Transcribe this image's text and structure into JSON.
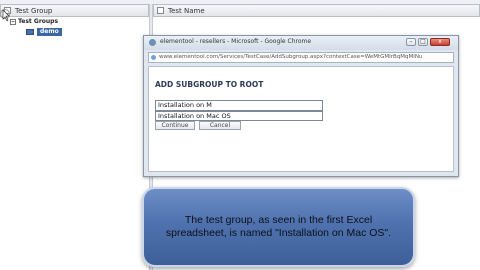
{
  "left_panel": {
    "header": "Test Group",
    "tree": {
      "root_label": "Test Groups",
      "child_label": "demo"
    }
  },
  "right_panel": {
    "header": "Test Name"
  },
  "browser": {
    "window_title": "elementool - resellers - Microsoft - Google Chrome",
    "url": "www.elementool.com/Services/TestCase/AddSubgroup.aspx?contextCase=WeMtGMIrBqMqMlNu",
    "dialog_title": "ADD SUBGROUP TO ROOT",
    "name_field_value": "Installation on M",
    "autocomplete_suggestion": "Installation on Mac OS",
    "continue_button": "Continue",
    "cancel_button": "Cancel",
    "window_buttons": {
      "minimize": "–",
      "maximize": "□",
      "close": "x"
    }
  },
  "caption": {
    "text": "The test group, as seen in the first Excel spreadsheet, is named \"Installation on Mac OS\"."
  },
  "colors": {
    "caption_bg": "#4f72ae",
    "selected_node": "#3c66a4",
    "close_button": "#c8402f"
  }
}
